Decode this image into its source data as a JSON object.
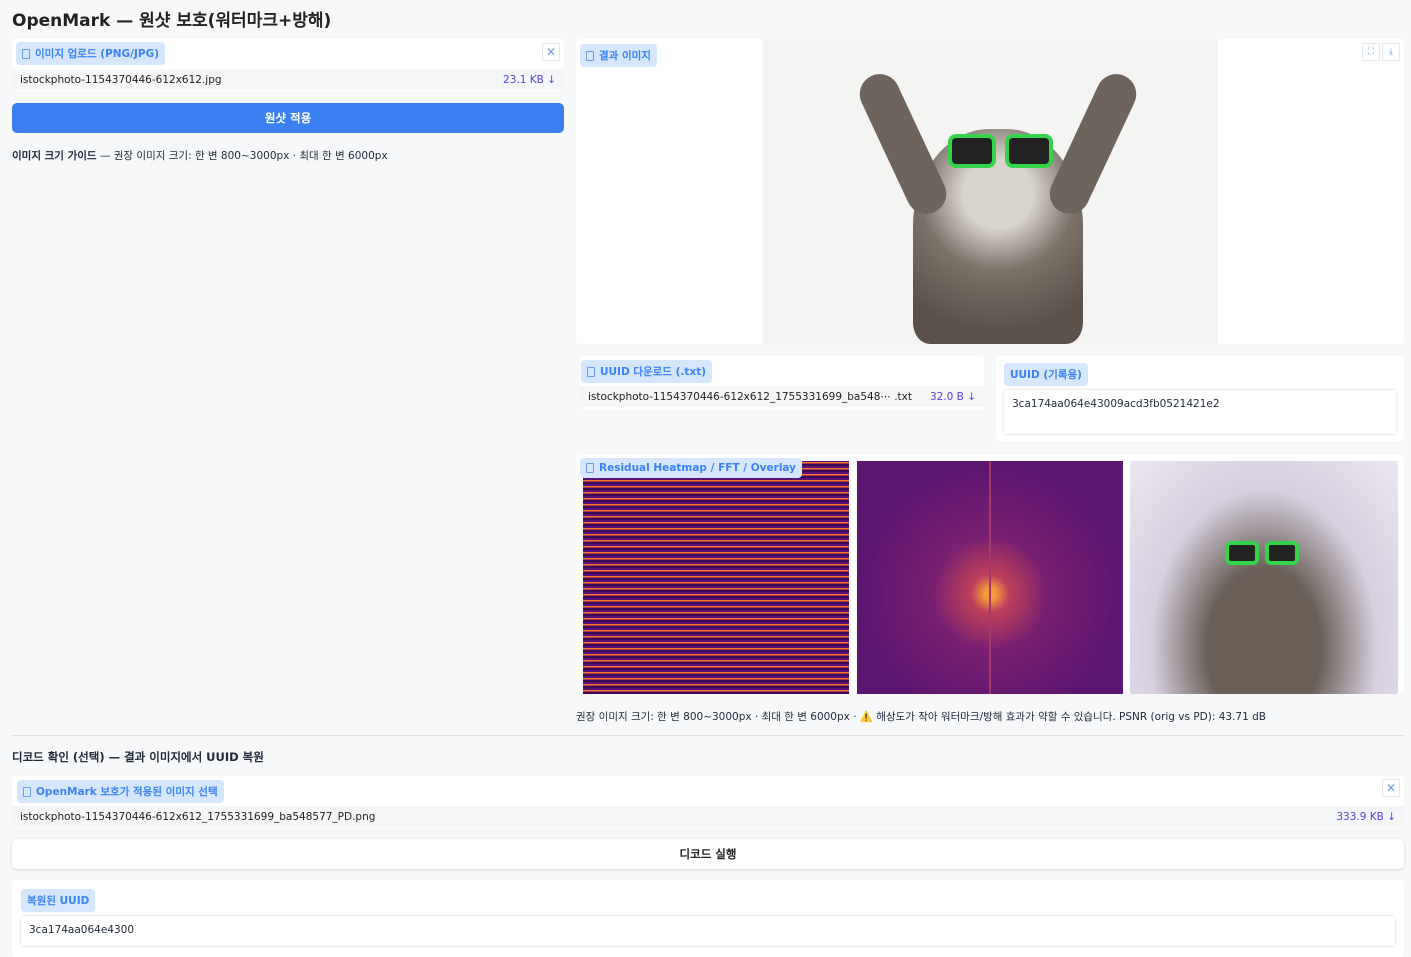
{
  "title": "OpenMark — 원샷 보호(워터마크+방해)",
  "upload": {
    "label": "이미지 업로드 (PNG/JPG)",
    "filename": "istockphoto-1154370446-612x612.jpg",
    "size": "23.1 KB ↓"
  },
  "apply_button": "원샷 적용",
  "guide": {
    "bold": "이미지 크기 가이드",
    "text": " — 권장 이미지 크기: 한 변 800~3000px · 최대 한 변 6000px"
  },
  "result": {
    "label": "결과 이미지",
    "icons": [
      "fullscreen-icon",
      "download-icon"
    ]
  },
  "uuid_download": {
    "label": "UUID 다운로드 (.txt)",
    "filename": "istockphoto-1154370446-612x612_1755331699_ba548⋯ .txt",
    "size": "32.0 B ↓"
  },
  "uuid_record": {
    "label": "UUID (기록용)",
    "value": "3ca174aa064e43009acd3fb0521421e2"
  },
  "gallery": {
    "label": "Residual Heatmap / FFT / Overlay"
  },
  "caption": "권장 이미지 크기: 한 변 800~3000px · 최대 한 변 6000px · ⚠️ 해상도가 작아 워터마크/방해 효과가 약할 수 있습니다. PSNR (orig vs PD): 43.71 dB",
  "decode": {
    "title": "디코드 확인 (선택) — 결과 이미지에서 UUID 복원",
    "file_label": "OpenMark 보호가 적용된 이미지 선택",
    "filename": "istockphoto-1154370446-612x612_1755331699_ba548577_PD.png",
    "size": "333.9 KB ↓",
    "button": "디코드 실행",
    "recovered_label": "복원된 UUID",
    "recovered_value": "3ca174aa064e4300"
  },
  "colors": {
    "accent": "#3b82f6",
    "label_bg": "#d6e6fd"
  }
}
